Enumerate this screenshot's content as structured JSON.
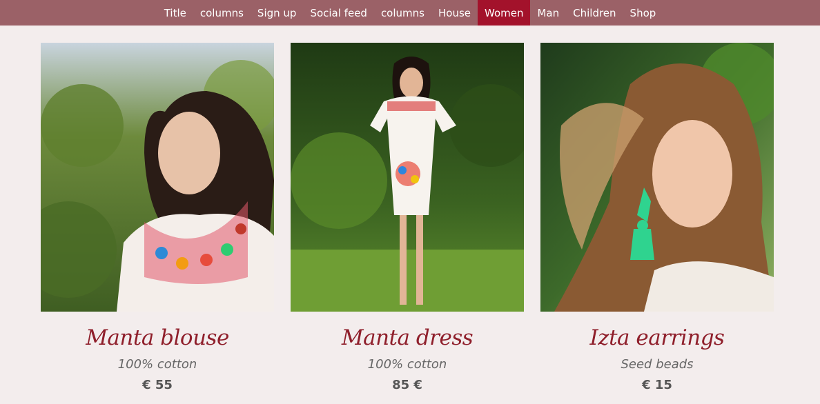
{
  "nav": {
    "items": [
      {
        "label": "Title",
        "active": false
      },
      {
        "label": "columns",
        "active": false
      },
      {
        "label": "Sign up",
        "active": false
      },
      {
        "label": "Social feed",
        "active": false
      },
      {
        "label": "columns",
        "active": false
      },
      {
        "label": "House",
        "active": false
      },
      {
        "label": "Women",
        "active": true
      },
      {
        "label": "Man",
        "active": false
      },
      {
        "label": "Children",
        "active": false
      },
      {
        "label": "Shop",
        "active": false
      }
    ]
  },
  "products": [
    {
      "name": "Manta blouse",
      "desc": "100% cotton",
      "price": "€ 55"
    },
    {
      "name": "Manta dress",
      "desc": "100% cotton",
      "price": "85 €"
    },
    {
      "name": "Izta earrings",
      "desc": "Seed beads",
      "price": "€ 15"
    }
  ],
  "colors": {
    "nav_bg": "#9b6167",
    "nav_active": "#a3122b",
    "page_bg": "#f3eded",
    "title": "#8f1f2b"
  }
}
